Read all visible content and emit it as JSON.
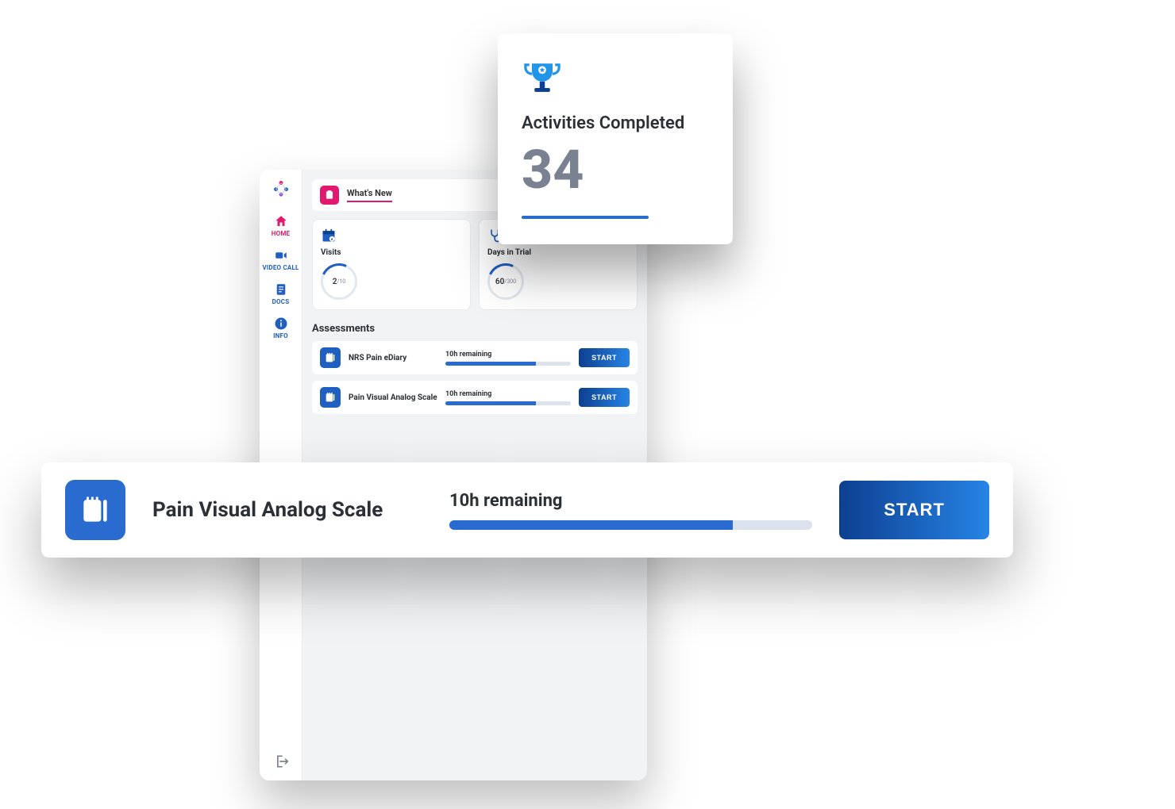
{
  "sidebar": {
    "items": [
      {
        "label": "HOME",
        "icon": "home-icon"
      },
      {
        "label": "VIDEO CALL",
        "icon": "video-icon"
      },
      {
        "label": "DOCS",
        "icon": "document-icon"
      },
      {
        "label": "INFO",
        "icon": "info-icon"
      }
    ]
  },
  "whats_new": {
    "label": "What's New"
  },
  "stats": {
    "visits": {
      "title": "Visits",
      "value": "2",
      "total": "/10"
    },
    "days": {
      "title": "Days in Trial",
      "value": "60",
      "total": "/300"
    }
  },
  "assessments": {
    "title": "Assessments",
    "items": [
      {
        "name": "NRS Pain eDiary",
        "remaining": "10h remaining",
        "progress": 72,
        "action": "START"
      },
      {
        "name": "Pain Visual Analog Scale",
        "remaining": "10h remaining",
        "progress": 72,
        "action": "START"
      }
    ]
  },
  "activities_card": {
    "title": "Activities Completed",
    "value": "34"
  },
  "featured_assessment": {
    "name": "Pain Visual Analog Scale",
    "remaining": "10h remaining",
    "progress": 78,
    "action": "START"
  }
}
